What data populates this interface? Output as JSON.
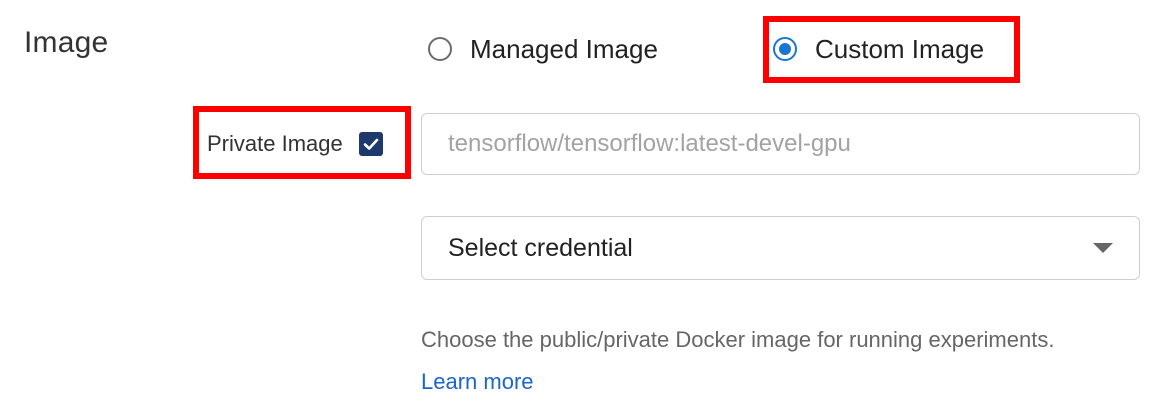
{
  "image_section": {
    "label": "Image",
    "source_options": [
      {
        "label": "Managed Image",
        "selected": false
      },
      {
        "label": "Custom Image",
        "selected": true
      }
    ],
    "private_image": {
      "label": "Private Image",
      "checked": true
    },
    "image_input": {
      "value": "",
      "placeholder": "tensorflow/tensorflow:latest-devel-gpu"
    },
    "credential_select": {
      "selected": "Select credential"
    },
    "help": {
      "text": "Choose the public/private Docker image for running experiments.",
      "link_label": "Learn more"
    }
  },
  "colors": {
    "accent": "#1976d2",
    "checkbox": "#1e3a6d",
    "highlight": "#ff0000",
    "link": "#1b66c9"
  },
  "icons": [
    "radio-unchecked-icon",
    "radio-checked-icon",
    "checkmark-icon",
    "dropdown-caret-icon"
  ]
}
